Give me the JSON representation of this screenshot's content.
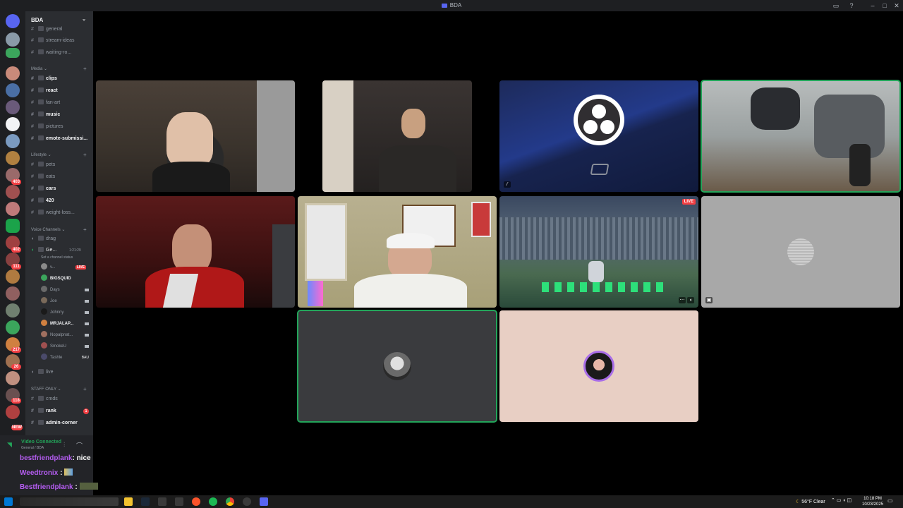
{
  "window": {
    "title": "BDA"
  },
  "server": {
    "name": "BDA"
  },
  "channels_top": [
    {
      "name": "general"
    },
    {
      "name": "stream-ideas"
    },
    {
      "name": "waiting-ro..."
    }
  ],
  "categories": {
    "media": "Media",
    "lifestyle": "Lifestyle",
    "voice": "Voice Channels",
    "staff": "STAFF ONLY"
  },
  "media_channels": [
    {
      "name": "clips",
      "unread": true
    },
    {
      "name": "react",
      "unread": true
    },
    {
      "name": "fan-art",
      "unread": false
    },
    {
      "name": "music",
      "unread": true
    },
    {
      "name": "pictures",
      "unread": false
    },
    {
      "name": "emote-submissi...",
      "unread": true
    }
  ],
  "lifestyle_channels": [
    {
      "name": "pets",
      "unread": false
    },
    {
      "name": "eats",
      "unread": false
    },
    {
      "name": "cars",
      "unread": true
    },
    {
      "name": "420",
      "unread": true
    },
    {
      "name": "weight-loss...",
      "unread": false
    }
  ],
  "voice_channels": {
    "drag": "drag",
    "general_label": "Ge...",
    "general_timer": "1:21:29",
    "status_hint": "Set a channel status",
    "live": "live"
  },
  "voice_users": [
    {
      "name": "v...",
      "bold": false,
      "live": true,
      "cam": false
    },
    {
      "name": "BIGSQUID",
      "bold": true,
      "live": false,
      "cam": false
    },
    {
      "name": "Days",
      "bold": false,
      "live": false,
      "cam": true
    },
    {
      "name": "Joe",
      "bold": false,
      "live": false,
      "cam": true
    },
    {
      "name": "Johnny",
      "bold": false,
      "live": false,
      "cam": true
    },
    {
      "name": "MRJALAP...",
      "bold": true,
      "live": false,
      "cam": true
    },
    {
      "name": "Nopalpnat...",
      "bold": false,
      "live": false,
      "cam": true
    },
    {
      "name": "SmokeU",
      "bold": false,
      "live": false,
      "cam": true
    },
    {
      "name": "Tashle",
      "bold": false,
      "live": false,
      "cam": false,
      "tag": "BAU"
    }
  ],
  "live_badge": "LIVE",
  "staff_channels": [
    {
      "name": "cmds",
      "unread": false
    },
    {
      "name": "rank",
      "unread": true,
      "badge": "1"
    },
    {
      "name": "admin-corner",
      "unread": true
    }
  ],
  "server_badges": [
    "403",
    "713",
    "402",
    "111",
    "217",
    "26",
    "118"
  ],
  "new_badge": "NEW",
  "voice_panel": {
    "status": "Video Connected",
    "location": "General / BDA"
  },
  "chat": [
    {
      "user": "bestfriendplank",
      "message": ": nice"
    },
    {
      "user": "Weedtronix",
      "message": ":"
    },
    {
      "user": "Bestfriendplank",
      "message": ":"
    },
    {
      "user": "bestfriendplank",
      "message": ":"
    }
  ],
  "tiles": [
    {
      "id": "cam-1",
      "kind": "webcam",
      "speaking": false
    },
    {
      "id": "cam-2",
      "kind": "webcam",
      "speaking": false
    },
    {
      "id": "obs",
      "kind": "obs",
      "speaking": false
    },
    {
      "id": "cam-room",
      "kind": "webcam",
      "speaking": true
    },
    {
      "id": "cam-red",
      "kind": "webcam",
      "speaking": false
    },
    {
      "id": "cam-hat",
      "kind": "webcam",
      "speaking": false
    },
    {
      "id": "stream-game",
      "kind": "stream",
      "speaking": false,
      "live": "LIVE"
    },
    {
      "id": "blank-grey",
      "kind": "blank",
      "speaking": false
    },
    {
      "id": "avatar-1",
      "kind": "avatar",
      "speaking": true
    },
    {
      "id": "avatar-2",
      "kind": "avatar",
      "speaking": false
    }
  ],
  "taskbar": {
    "weather": "56°F Clear",
    "time": "10:18 PM",
    "date": "10/23/2025"
  },
  "colors": {
    "accent": "#5865f2",
    "speaking": "#23a55a",
    "live": "#f23f43",
    "chat_user": "#b45cf0"
  }
}
